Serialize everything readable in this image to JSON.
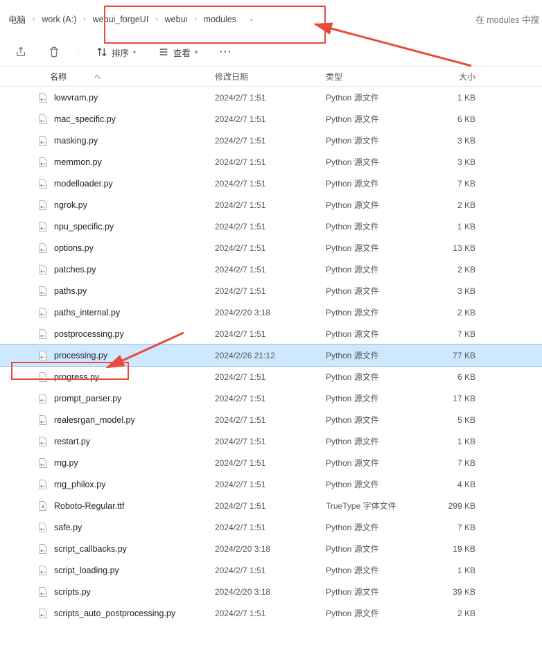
{
  "breadcrumb": {
    "items": [
      "电脑",
      "work (A:)",
      "webui_forgeUI",
      "webui",
      "modules"
    ]
  },
  "search": {
    "placeholder": "在 modules 中搜"
  },
  "toolbar": {
    "sort_label": "排序",
    "view_label": "查看"
  },
  "columns": {
    "name": "名称",
    "date": "修改日期",
    "type": "类型",
    "size": "大小"
  },
  "type_labels": {
    "python": "Python 源文件",
    "ttf": "TrueType 字体文件"
  },
  "files": [
    {
      "name": "lowvram.py",
      "date": "2024/2/7 1:51",
      "type": "python",
      "size": "1 KB",
      "icon": "py"
    },
    {
      "name": "mac_specific.py",
      "date": "2024/2/7 1:51",
      "type": "python",
      "size": "6 KB",
      "icon": "py"
    },
    {
      "name": "masking.py",
      "date": "2024/2/7 1:51",
      "type": "python",
      "size": "3 KB",
      "icon": "py"
    },
    {
      "name": "memmon.py",
      "date": "2024/2/7 1:51",
      "type": "python",
      "size": "3 KB",
      "icon": "py"
    },
    {
      "name": "modelloader.py",
      "date": "2024/2/7 1:51",
      "type": "python",
      "size": "7 KB",
      "icon": "py"
    },
    {
      "name": "ngrok.py",
      "date": "2024/2/7 1:51",
      "type": "python",
      "size": "2 KB",
      "icon": "py"
    },
    {
      "name": "npu_specific.py",
      "date": "2024/2/7 1:51",
      "type": "python",
      "size": "1 KB",
      "icon": "py"
    },
    {
      "name": "options.py",
      "date": "2024/2/7 1:51",
      "type": "python",
      "size": "13 KB",
      "icon": "py"
    },
    {
      "name": "patches.py",
      "date": "2024/2/7 1:51",
      "type": "python",
      "size": "2 KB",
      "icon": "py"
    },
    {
      "name": "paths.py",
      "date": "2024/2/7 1:51",
      "type": "python",
      "size": "3 KB",
      "icon": "py"
    },
    {
      "name": "paths_internal.py",
      "date": "2024/2/20 3:18",
      "type": "python",
      "size": "2 KB",
      "icon": "py"
    },
    {
      "name": "postprocessing.py",
      "date": "2024/2/7 1:51",
      "type": "python",
      "size": "7 KB",
      "icon": "py"
    },
    {
      "name": "processing.py",
      "date": "2024/2/26 21:12",
      "type": "python",
      "size": "77 KB",
      "icon": "py",
      "selected": true
    },
    {
      "name": "progress.py",
      "date": "2024/2/7 1:51",
      "type": "python",
      "size": "6 KB",
      "icon": "py"
    },
    {
      "name": "prompt_parser.py",
      "date": "2024/2/7 1:51",
      "type": "python",
      "size": "17 KB",
      "icon": "py"
    },
    {
      "name": "realesrgan_model.py",
      "date": "2024/2/7 1:51",
      "type": "python",
      "size": "5 KB",
      "icon": "py"
    },
    {
      "name": "restart.py",
      "date": "2024/2/7 1:51",
      "type": "python",
      "size": "1 KB",
      "icon": "py"
    },
    {
      "name": "rng.py",
      "date": "2024/2/7 1:51",
      "type": "python",
      "size": "7 KB",
      "icon": "py"
    },
    {
      "name": "rng_philox.py",
      "date": "2024/2/7 1:51",
      "type": "python",
      "size": "4 KB",
      "icon": "py"
    },
    {
      "name": "Roboto-Regular.ttf",
      "date": "2024/2/7 1:51",
      "type": "ttf",
      "size": "299 KB",
      "icon": "ttf"
    },
    {
      "name": "safe.py",
      "date": "2024/2/7 1:51",
      "type": "python",
      "size": "7 KB",
      "icon": "py"
    },
    {
      "name": "script_callbacks.py",
      "date": "2024/2/20 3:18",
      "type": "python",
      "size": "19 KB",
      "icon": "py"
    },
    {
      "name": "script_loading.py",
      "date": "2024/2/7 1:51",
      "type": "python",
      "size": "1 KB",
      "icon": "py"
    },
    {
      "name": "scripts.py",
      "date": "2024/2/20 3:18",
      "type": "python",
      "size": "39 KB",
      "icon": "py"
    },
    {
      "name": "scripts_auto_postprocessing.py",
      "date": "2024/2/7 1:51",
      "type": "python",
      "size": "2 KB",
      "icon": "py"
    }
  ]
}
